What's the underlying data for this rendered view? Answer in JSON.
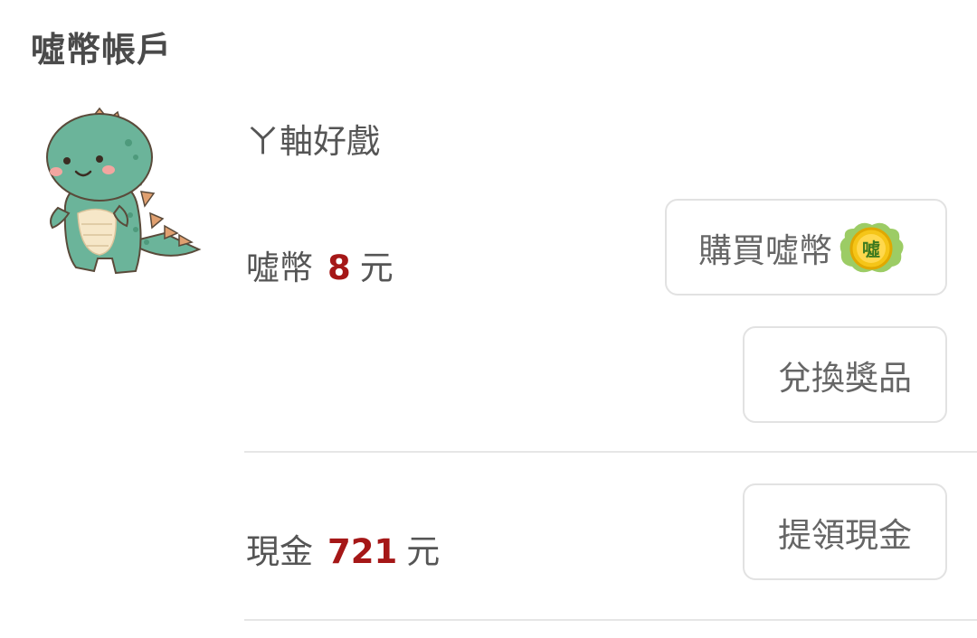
{
  "header": {
    "title": "噓幣帳戶"
  },
  "profile": {
    "avatar_icon": "dinosaur-avatar-icon",
    "username": "ㄚ軸好戲"
  },
  "coins": {
    "label": "噓幣",
    "amount": "8",
    "unit": "元",
    "buy_button_label": "購買噓幣",
    "buy_button_icon": "coin-icon",
    "coin_icon_text": "噓",
    "redeem_button_label": "兌換獎品"
  },
  "cash": {
    "label": "現金",
    "amount": "721",
    "unit": "元",
    "withdraw_button_label": "提領現金"
  },
  "colors": {
    "amount": "#a51717",
    "button_border": "#e2e2e2",
    "divider": "#e6e6e6"
  }
}
